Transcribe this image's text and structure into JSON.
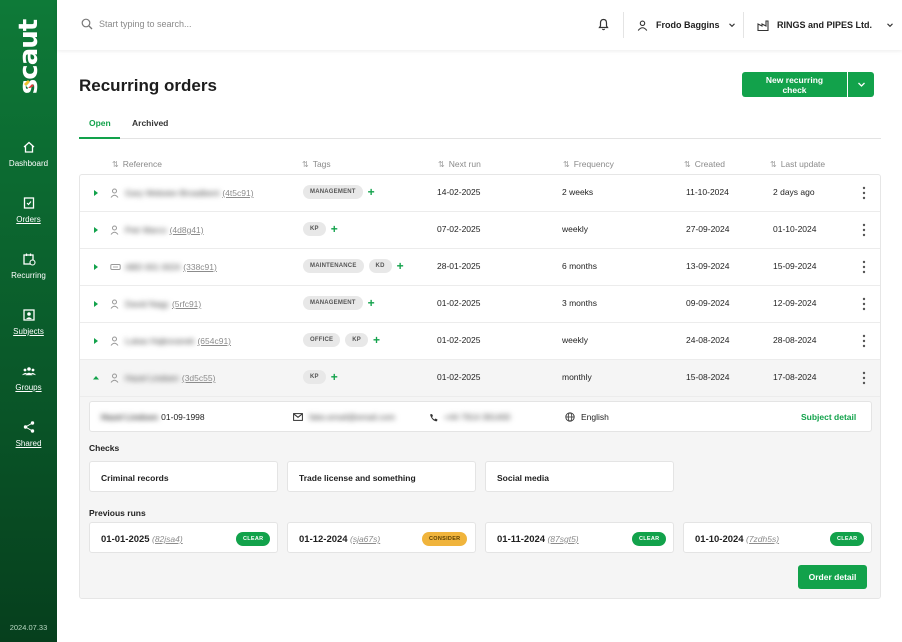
{
  "app": {
    "logo_text": "scaut",
    "version": "2024.07.33"
  },
  "sidebar": {
    "items": [
      {
        "label": "Dashboard",
        "icon": "home-icon"
      },
      {
        "label": "Orders",
        "icon": "orders-icon"
      },
      {
        "label": "Recurring",
        "icon": "recurring-icon"
      },
      {
        "label": "Subjects",
        "icon": "subjects-icon"
      },
      {
        "label": "Groups",
        "icon": "groups-icon"
      },
      {
        "label": "Shared",
        "icon": "share-icon"
      }
    ]
  },
  "topbar": {
    "search_placeholder": "Start typing to search...",
    "user_name": "Frodo Baggins",
    "company_name": "RINGS and PIPES Ltd."
  },
  "page": {
    "title": "Recurring orders",
    "new_button": "New recurring check"
  },
  "tabs": [
    {
      "label": "Open"
    },
    {
      "label": "Archived"
    }
  ],
  "columns": [
    "Reference",
    "Tags",
    "Next run",
    "Frequency",
    "Created",
    "Last update"
  ],
  "rows": [
    {
      "name": "Gary Webster-Broadbent",
      "id": "(4t5c91)",
      "tags": [
        "MANAGEMENT"
      ],
      "next_run": "14-02-2025",
      "frequency": "2 weeks",
      "created": "11-10-2024",
      "updated": "2 days ago",
      "icon": "person-icon"
    },
    {
      "name": "Petr Marco",
      "id": "(4d8g41)",
      "tags": [
        "KP"
      ],
      "next_run": "07-02-2025",
      "frequency": "weekly",
      "created": "27-09-2024",
      "updated": "01-10-2024",
      "icon": "person-icon"
    },
    {
      "name": "ABD 001 0024",
      "id": "(338c91)",
      "tags": [
        "MAINTENANCE",
        "KD"
      ],
      "next_run": "28-01-2025",
      "frequency": "6 months",
      "created": "13-09-2024",
      "updated": "15-09-2024",
      "icon": "vehicle-icon"
    },
    {
      "name": "David Nagy",
      "id": "(5rfc91)",
      "tags": [
        "MANAGEMENT"
      ],
      "next_run": "01-02-2025",
      "frequency": "3 months",
      "created": "09-09-2024",
      "updated": "12-09-2024",
      "icon": "person-icon"
    },
    {
      "name": "Lukas Hajkovanek",
      "id": "(654c91)",
      "tags": [
        "OFFICE",
        "KP"
      ],
      "next_run": "01-02-2025",
      "frequency": "weekly",
      "created": "24-08-2024",
      "updated": "28-08-2024",
      "icon": "person-icon"
    },
    {
      "name": "Hazel Lindsen",
      "id": "(3d5c55)",
      "tags": [
        "KP"
      ],
      "next_run": "01-02-2025",
      "frequency": "monthly",
      "created": "15-08-2024",
      "updated": "17-08-2024",
      "icon": "person-icon"
    }
  ],
  "detail": {
    "subject_name": "Hazel Lindsen",
    "dob": "01-09-1998",
    "email": "fake.email@email.com",
    "phone": "+44 7914 391400",
    "language": "English",
    "subject_link": "Subject detail",
    "checks_label": "Checks",
    "checks": [
      "Criminal records",
      "Trade license and something",
      "Social media"
    ],
    "runs_label": "Previous runs",
    "runs": [
      {
        "date": "01-01-2025",
        "id": "(82jsa4)",
        "status": "CLEAR"
      },
      {
        "date": "01-12-2024",
        "id": "(sja67s)",
        "status": "CONSIDER"
      },
      {
        "date": "01-11-2024",
        "id": "(87sgt5)",
        "status": "CLEAR"
      },
      {
        "date": "01-10-2024",
        "id": "(7zdh5s)",
        "status": "CLEAR"
      }
    ],
    "order_button": "Order detail"
  },
  "colors": {
    "accent": "#12a24b",
    "consider": "#f0b43c",
    "sidebar": "#0a5a2a"
  }
}
